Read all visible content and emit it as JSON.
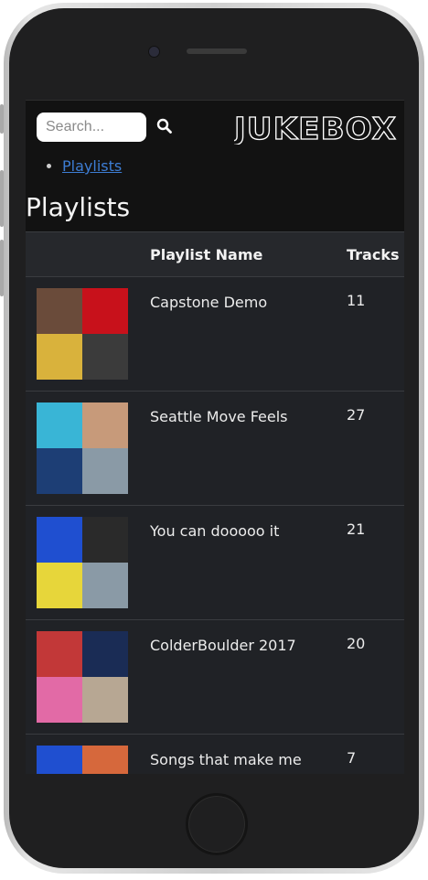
{
  "header": {
    "search_placeholder": "Search...",
    "logo_text": "JUKEBOX"
  },
  "breadcrumb": {
    "item": "Playlists"
  },
  "page_title": "Playlists",
  "table": {
    "columns": [
      "",
      "Playlist Name",
      "Tracks"
    ],
    "rows": [
      {
        "name": "Capstone Demo",
        "tracks": "11",
        "cover_colors": [
          "#6a4b3a",
          "#c8111b",
          "#d9b23c",
          "#3b3b3b"
        ]
      },
      {
        "name": "Seattle Move Feels",
        "tracks": "27",
        "cover_colors": [
          "#39b5d6",
          "#c79a7a",
          "#1d3e75",
          "#8a9aa6"
        ]
      },
      {
        "name": "You can dooooo it",
        "tracks": "21",
        "cover_colors": [
          "#1f4fd0",
          "#2a2a2a",
          "#e7d63a",
          "#8a9aa6"
        ]
      },
      {
        "name": "ColderBoulder 2017",
        "tracks": "20",
        "cover_colors": [
          "#c23838",
          "#1a2c55",
          "#e26aa6",
          "#b7a793"
        ]
      },
      {
        "name": "Songs that make me think of Home",
        "tracks": "7",
        "cover_colors": [
          "#1f4fd0",
          "#d6683c",
          "#2a2a2a",
          "#444444"
        ]
      }
    ]
  }
}
